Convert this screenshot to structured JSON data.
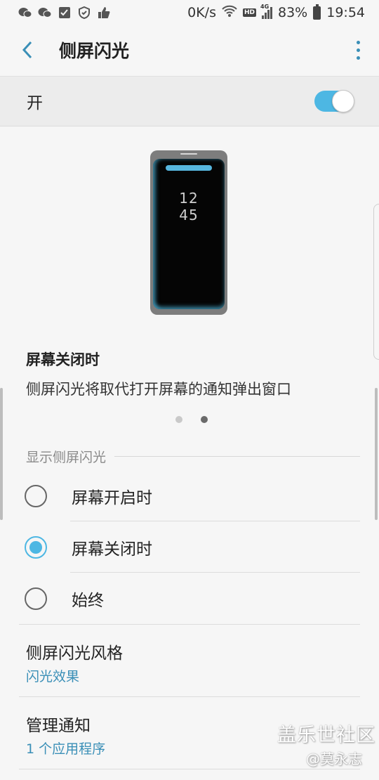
{
  "status_bar": {
    "speed": "0K/s",
    "network": "4G",
    "hd_badge": "HD",
    "battery": "83%",
    "time": "19:54",
    "left_icons": [
      "wechat-icon",
      "wechat-icon",
      "checklist-icon",
      "shield-icon",
      "thumbs-up-icon"
    ]
  },
  "header": {
    "title": "侧屏闪光"
  },
  "master_switch": {
    "label": "开",
    "enabled": true
  },
  "illustration": {
    "clock_hour": "12",
    "clock_minute": "45"
  },
  "description": {
    "title": "屏幕关闭时",
    "body": "侧屏闪光将取代打开屏幕的通知弹出窗口"
  },
  "pager": {
    "count": 2,
    "active_index": 1
  },
  "show_section": {
    "header": "显示侧屏闪光",
    "options": [
      {
        "label": "屏幕开启时",
        "selected": false
      },
      {
        "label": "屏幕关闭时",
        "selected": true
      },
      {
        "label": "始终",
        "selected": false
      }
    ]
  },
  "style_pref": {
    "title": "侧屏闪光风格",
    "value": "闪光效果"
  },
  "manage_pref": {
    "title": "管理通知",
    "value": "1 个应用程序"
  },
  "watermark": {
    "line1": "盖乐世社区",
    "line2": "@莫永志"
  },
  "colors": {
    "accent": "#4db7e3",
    "link": "#3a8fb7",
    "background": "#f6f6f6"
  }
}
